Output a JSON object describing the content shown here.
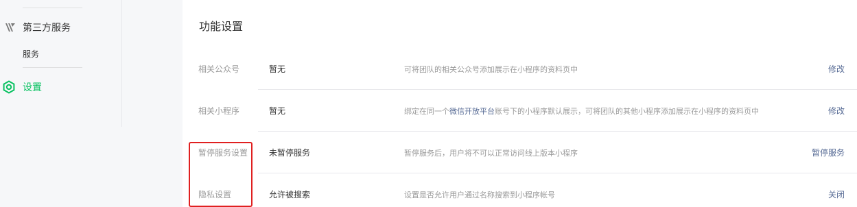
{
  "sidebar": {
    "group_title": "第三方服务",
    "group_icon": "third-party-icon",
    "sub_item": "服务",
    "active_item": "设置",
    "active_icon": "gear-icon",
    "active_color": "#07c160"
  },
  "main": {
    "section_title": "功能设置",
    "rows": [
      {
        "label": "相关公众号",
        "value": "暂无",
        "desc": "可将团队的相关公众号添加展示在小程序的资料页中",
        "action": "修改"
      },
      {
        "label": "相关小程序",
        "value": "暂无",
        "desc_pre": "绑定在同一个",
        "desc_link": "微信开放平台",
        "desc_post": "账号下的小程序默认展示，可将团队的其他小程序添加展示在小程序的资料页中",
        "action": "修改"
      },
      {
        "label": "暂停服务设置",
        "value": "未暂停服务",
        "desc": "暂停服务后，用户将不可以正常访问线上版本小程序",
        "action": "暂停服务"
      },
      {
        "label": "隐私设置",
        "value": "允许被搜索",
        "desc": "设置是否允许用户通过名称搜索到小程序帐号",
        "action": "关闭"
      }
    ]
  },
  "colors": {
    "link": "#576b95",
    "highlight": "#e02020"
  }
}
